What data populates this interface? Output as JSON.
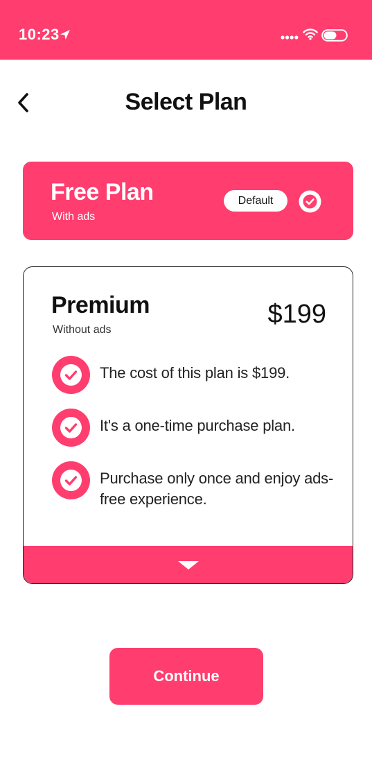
{
  "status_bar": {
    "time": "10:23",
    "icons": [
      "location-arrow-icon",
      "signal-dots-icon",
      "wifi-icon",
      "battery-toggle-icon"
    ]
  },
  "header": {
    "back_icon": "chevron-left-icon",
    "title": "Select Plan"
  },
  "plans": {
    "free": {
      "name": "Free Plan",
      "subtitle": "With ads",
      "badge": "Default",
      "selected": true,
      "check_icon": "check-circle-icon"
    },
    "premium": {
      "name": "Premium",
      "subtitle": "Without ads",
      "price": "$199",
      "features": [
        {
          "text": "The cost of this plan is $199.",
          "icon": "check-circle-icon"
        },
        {
          "text": "It's a one-time purchase plan.",
          "icon": "check-circle-icon"
        },
        {
          "text": "Purchase only once and enjoy ads-free experience.",
          "icon": "check-circle-icon"
        }
      ],
      "expand_icon": "caret-down-icon"
    }
  },
  "actions": {
    "continue_label": "Continue"
  },
  "colors": {
    "accent": "#ff3d6e",
    "text": "#111111",
    "background": "#ffffff"
  }
}
